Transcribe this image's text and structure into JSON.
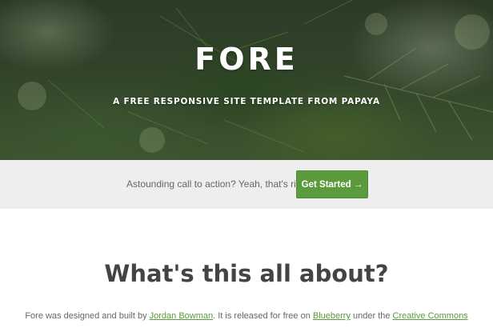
{
  "hero": {
    "title": "FORE",
    "subtitle": "A FREE RESPONSIVE SITE TEMPLATE FROM PAPAYA"
  },
  "cta": {
    "text": "Astounding call to action? Yeah, that's right.",
    "button_label": "Get Started →"
  },
  "about": {
    "heading": "What's this all about?",
    "intro_part1": "Fore was designed and built by ",
    "author_link": "Jordan Bowman",
    "intro_part2": ". It is released for free on ",
    "blueberry_link": "Blueberry",
    "intro_part3": " under the ",
    "license_link": "Creative Commons"
  },
  "colors": {
    "accent": "#5b9a3d",
    "cta_background": "#eeeeee",
    "heading": "#444444",
    "body_text": "#666666"
  }
}
